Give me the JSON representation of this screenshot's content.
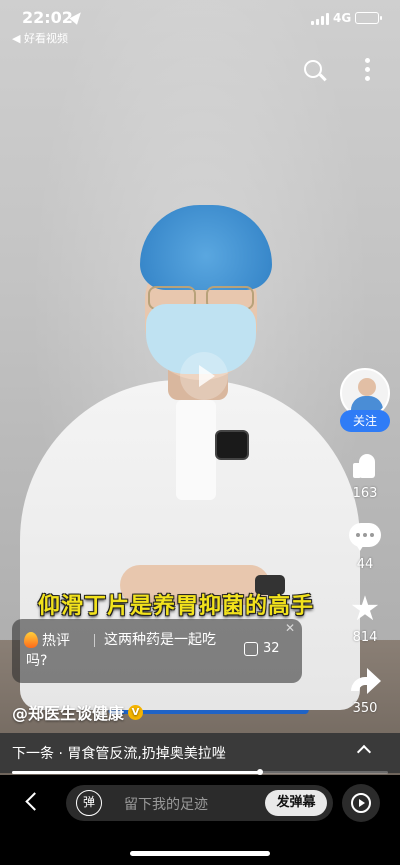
{
  "status_bar": {
    "time": "22:02",
    "network": "4G",
    "back_app": "◀ 好看视频"
  },
  "video": {
    "subtitle": "仰滑丁片是养胃抑菌的高手"
  },
  "author": {
    "name": "@郑医生谈健康",
    "follow_label": "关注",
    "verified_mark": "V"
  },
  "actions": {
    "likes": "163",
    "comments": "44",
    "favorites": "814",
    "shares": "350"
  },
  "hot_comment": {
    "tag": "热评",
    "text": "这两种药是一起吃吗?",
    "likes": "32",
    "close": "✕"
  },
  "next_video": {
    "text": "下一条 · 胃食管反流,扔掉奥美拉唑"
  },
  "playback": {
    "progress_fraction": 0.66
  },
  "bottom_bar": {
    "danmaku_icon_label": "弹",
    "placeholder": "留下我的足迹",
    "danmaku_button": "发弹幕"
  },
  "colors": {
    "accent": "#2f7cf6",
    "subtitle": "#f2e21c",
    "battery": "#4cd964"
  }
}
